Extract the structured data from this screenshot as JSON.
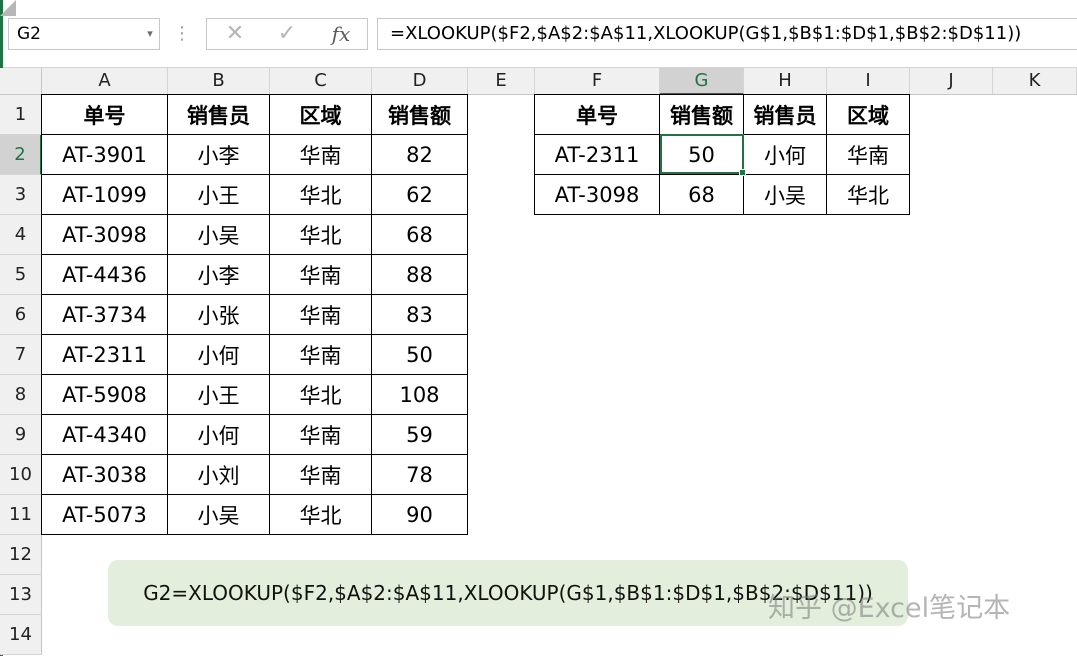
{
  "formula_bar": {
    "name_box": "G2",
    "name_box_arrow": "▾",
    "separator": "⋮",
    "cancel_icon": "✕",
    "enter_icon": "✓",
    "fx_icon": "fx",
    "formula": "=XLOOKUP($F2,$A$2:$A$11,XLOOKUP(G$1,$B$1:$D$1,$B$2:$D$11))"
  },
  "sheet": {
    "columns": [
      "A",
      "B",
      "C",
      "D",
      "E",
      "F",
      "G",
      "H",
      "I",
      "J",
      "K"
    ],
    "rows": [
      "1",
      "2",
      "3",
      "4",
      "5",
      "6",
      "7",
      "8",
      "9",
      "10",
      "11",
      "12",
      "13",
      "14"
    ],
    "selected_cell": "G2",
    "source_table": {
      "headers": [
        "单号",
        "销售员",
        "区域",
        "销售额"
      ],
      "rows": [
        [
          "AT-3901",
          "小李",
          "华南",
          "82"
        ],
        [
          "AT-1099",
          "小王",
          "华北",
          "62"
        ],
        [
          "AT-3098",
          "小吴",
          "华北",
          "68"
        ],
        [
          "AT-4436",
          "小李",
          "华南",
          "88"
        ],
        [
          "AT-3734",
          "小张",
          "华南",
          "83"
        ],
        [
          "AT-2311",
          "小何",
          "华南",
          "50"
        ],
        [
          "AT-5908",
          "小王",
          "华北",
          "108"
        ],
        [
          "AT-4340",
          "小何",
          "华南",
          "59"
        ],
        [
          "AT-3038",
          "小刘",
          "华南",
          "78"
        ],
        [
          "AT-5073",
          "小吴",
          "华北",
          "90"
        ]
      ]
    },
    "lookup_table": {
      "headers": [
        "单号",
        "销售额",
        "销售员",
        "区域"
      ],
      "rows": [
        [
          "AT-2311",
          "50",
          "小何",
          "华南"
        ],
        [
          "AT-3098",
          "68",
          "小吴",
          "华北"
        ]
      ]
    }
  },
  "callout": {
    "text": "G2=XLOOKUP($F2,$A$2:$A$11,XLOOKUP(G$1,$B$1:$D$1,$B$2:$D$11))"
  },
  "watermark": "知乎 @Excel笔记本",
  "colors": {
    "accent": "#217346",
    "callout_bg": "#e3efdc",
    "header_bg": "#f0f0f0"
  }
}
